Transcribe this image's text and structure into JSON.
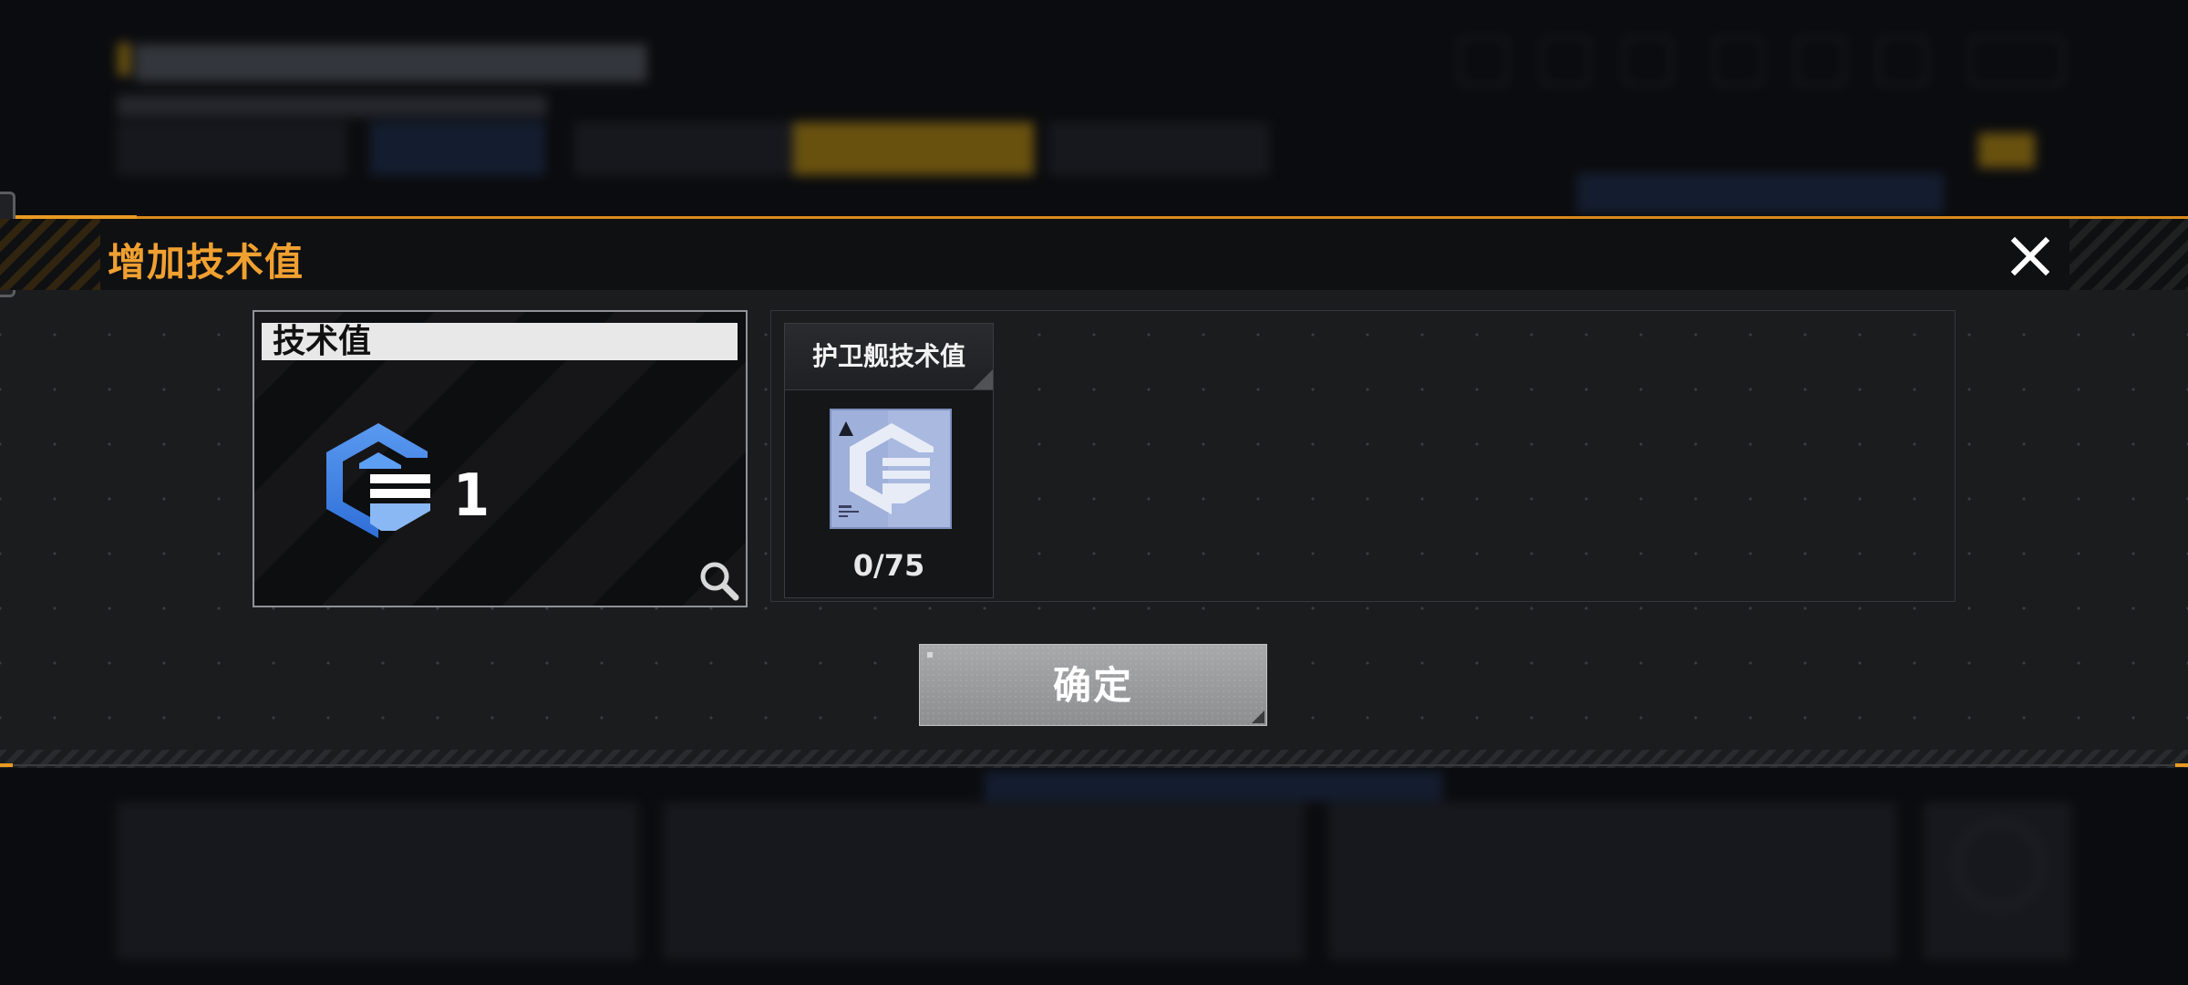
{
  "dialog": {
    "title": "增加技术值",
    "close_icon": "close-icon",
    "accent_color": "#f0a030"
  },
  "tech_card": {
    "title": "技术值",
    "icon": "tech-value-icon",
    "count": "1",
    "magnify_icon": "magnify-icon"
  },
  "item_card": {
    "title": "护卫舰技术值",
    "icon": "frigate-tech-item-icon",
    "progress": "0/75"
  },
  "confirm_button": {
    "label": "确定"
  }
}
